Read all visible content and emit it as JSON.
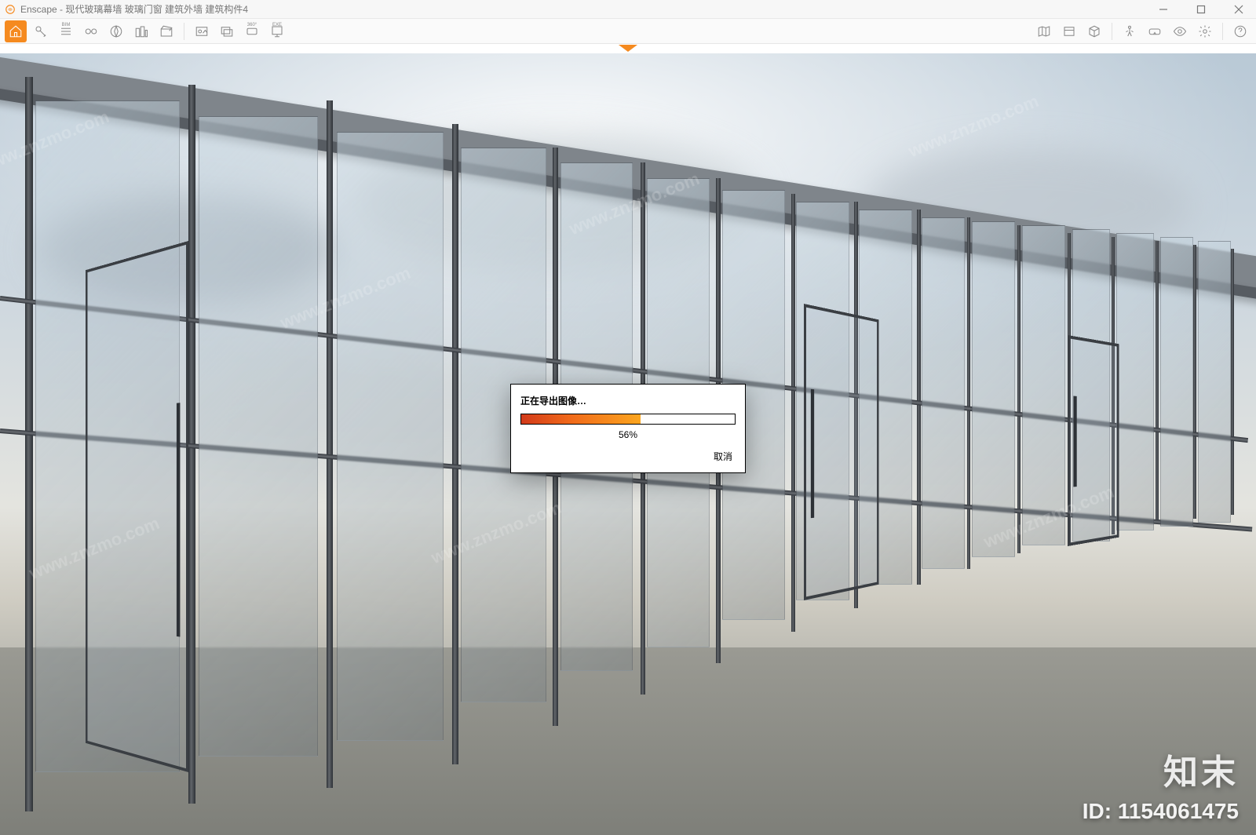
{
  "app": {
    "name": "Enscape",
    "title": "Enscape - 现代玻璃幕墙 玻璃门窗 建筑外墙 建筑构件4"
  },
  "window_controls": {
    "minimize": "–",
    "maximize": "☐",
    "close": "✕"
  },
  "toolbar": {
    "left": [
      {
        "name": "home-icon",
        "label": "Home"
      },
      {
        "name": "key-icon",
        "label": "License"
      },
      {
        "name": "list-icon",
        "label": "BIM",
        "badge": "BIM"
      },
      {
        "name": "binoculars-icon",
        "label": "Views"
      },
      {
        "name": "compass-icon",
        "label": "Orbit"
      },
      {
        "name": "buildings-icon",
        "label": "Assets"
      },
      {
        "name": "clapper-icon",
        "label": "Video"
      }
    ],
    "left2": [
      {
        "name": "screenshot-icon",
        "label": "Screenshot"
      },
      {
        "name": "batch-render-icon",
        "label": "Batch"
      },
      {
        "name": "panorama-icon",
        "label": "Panorama",
        "badge": "360°"
      },
      {
        "name": "export-exe-icon",
        "label": "EXE",
        "badge": "EXE"
      }
    ],
    "right": [
      {
        "name": "map-icon",
        "label": "Map"
      },
      {
        "name": "paper-icon",
        "label": "Paper"
      },
      {
        "name": "cube-icon",
        "label": "3D"
      },
      {
        "name": "walk-icon",
        "label": "Walk"
      },
      {
        "name": "vr-icon",
        "label": "VR"
      },
      {
        "name": "eye-icon",
        "label": "Visual"
      },
      {
        "name": "gear-icon",
        "label": "Settings"
      },
      {
        "name": "help-icon",
        "label": "Help"
      }
    ]
  },
  "modal": {
    "caption": "正在导出图像…",
    "percent_value": 56,
    "percent_text": "56%",
    "cancel": "取消"
  },
  "watermark": {
    "logo_text": "知末",
    "id_label": "ID: 1154061475",
    "url": "www.znzmo.com"
  },
  "colors": {
    "accent": "#f58a1f",
    "titlebar_text": "#777777",
    "modal_border": "#000000"
  }
}
